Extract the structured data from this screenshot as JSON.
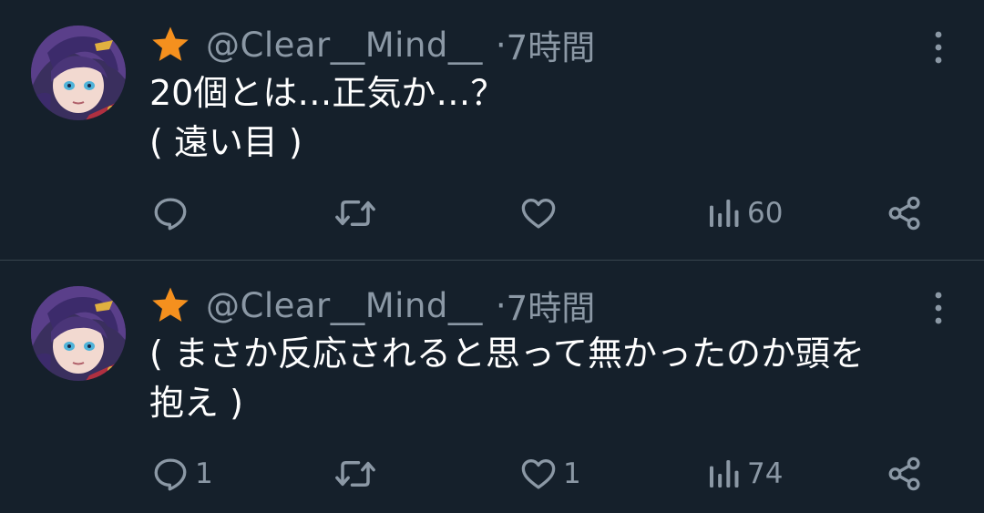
{
  "tweets": [
    {
      "handle": "@Clear__Mind__",
      "separator": "·",
      "time": "7時間",
      "text_lines": [
        "20個とは…正気か…？",
        "( 遠い目 )"
      ],
      "replies": "",
      "retweets": "",
      "likes": "",
      "views": "60"
    },
    {
      "handle": "@Clear__Mind__",
      "separator": "·",
      "time": "7時間",
      "text_lines": [
        "( まさか反応されると思って無かったのか頭を",
        "抱え )"
      ],
      "replies": "1",
      "retweets": "",
      "likes": "1",
      "views": "74"
    }
  ],
  "icons": {
    "badge": "star-icon",
    "more": "more-vertical-icon",
    "reply": "reply-icon",
    "retweet": "retweet-icon",
    "like": "heart-icon",
    "views": "views-icon",
    "share": "share-icon"
  },
  "colors": {
    "background": "#15202b",
    "divider": "#38444d",
    "muted_text": "#8b98a5",
    "star": "#f5901e",
    "text": "#ffffff"
  }
}
